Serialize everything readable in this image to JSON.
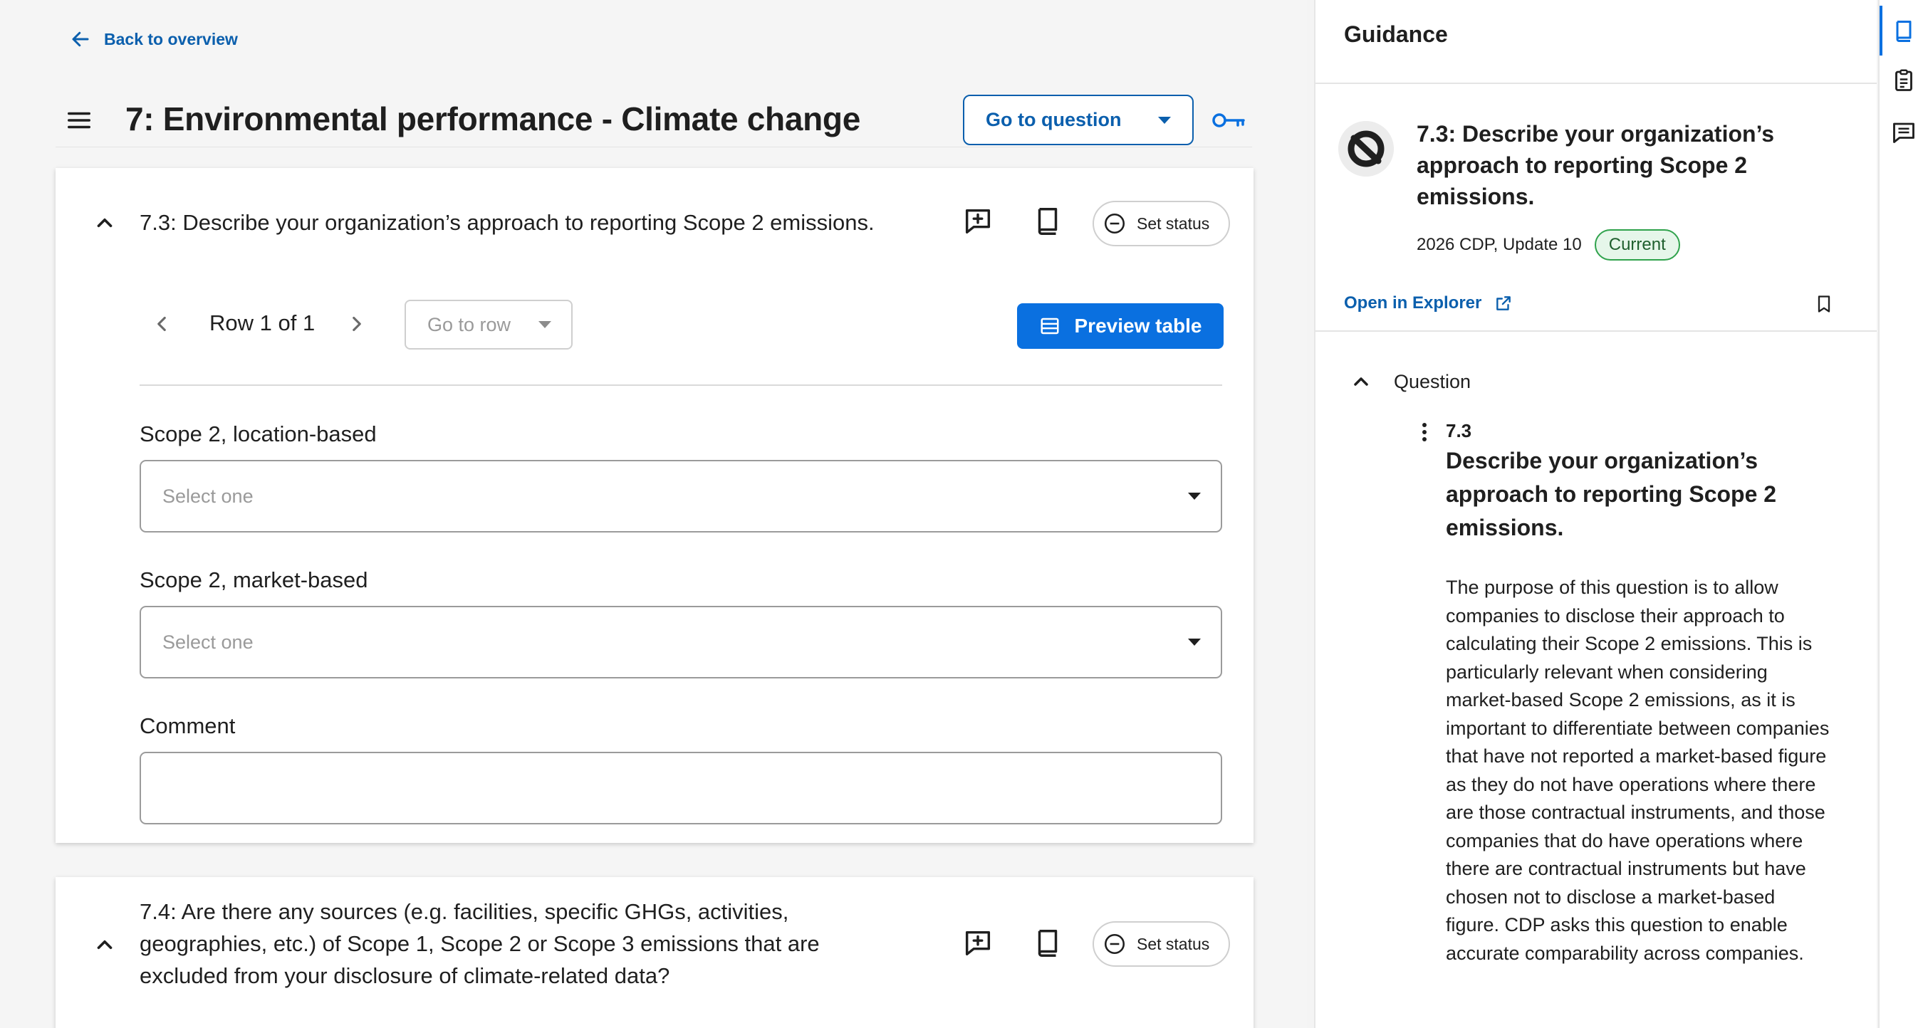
{
  "header": {
    "back_label": "Back to overview",
    "title": "7: Environmental performance - Climate change",
    "goto_question_label": "Go to question"
  },
  "question_73": {
    "title": "7.3: Describe your organization’s approach to reporting Scope 2 emissions.",
    "set_status_label": "Set status",
    "row_label": "Row 1 of 1",
    "goto_row_placeholder": "Go to row",
    "preview_label": "Preview table",
    "fields": [
      {
        "label": "Scope 2, location-based",
        "placeholder": "Select one"
      },
      {
        "label": "Scope 2, market-based",
        "placeholder": "Select one"
      },
      {
        "label": "Comment",
        "value": ""
      }
    ]
  },
  "question_74": {
    "title_lines": [
      "7.4: Are there any sources (e.g. facilities, specific GHGs, activities,",
      "geographies, etc.) of Scope 1, Scope 2 or Scope 3 emissions that are",
      "excluded from your disclosure of climate-related data?"
    ],
    "set_status_label": "Set status"
  },
  "guidance": {
    "title": "Guidance",
    "heading": "7.3: Describe your organization’s approach to reporting Scope 2 emissions.",
    "version": "2026 CDP, Update 10",
    "badge": "Current",
    "open_explorer_label": "Open in Explorer",
    "section_label": "Question",
    "q_number": "7.3",
    "q_title": "Describe your organization’s approach to reporting Scope 2 emissions.",
    "body": "The purpose of this question is to allow companies to disclose their approach to calculating their Scope 2 emissions. This is particularly relevant when considering market-based Scope 2 emissions, as it is important to differentiate between companies that have not reported a market-based figure as they do not have operations where there are those contractual instruments, and those companies that do have operations where there are contractual instruments but have chosen not to disclose a market-based figure. CDP asks this question to enable accurate comparability across companies."
  },
  "colors": {
    "accent": "#0a70e0",
    "link": "#0b5fad",
    "badge_border": "#2fa24c"
  },
  "icons": [
    "arrow-left-icon",
    "hamburger-icon",
    "key-icon",
    "chevron-up-icon",
    "comment-add-icon",
    "book-icon",
    "minus-circle-icon",
    "chevron-left-icon",
    "chevron-right-icon",
    "table-icon",
    "external-link-icon",
    "bookmark-icon",
    "kebab-icon",
    "clipboard-icon",
    "message-icon"
  ]
}
